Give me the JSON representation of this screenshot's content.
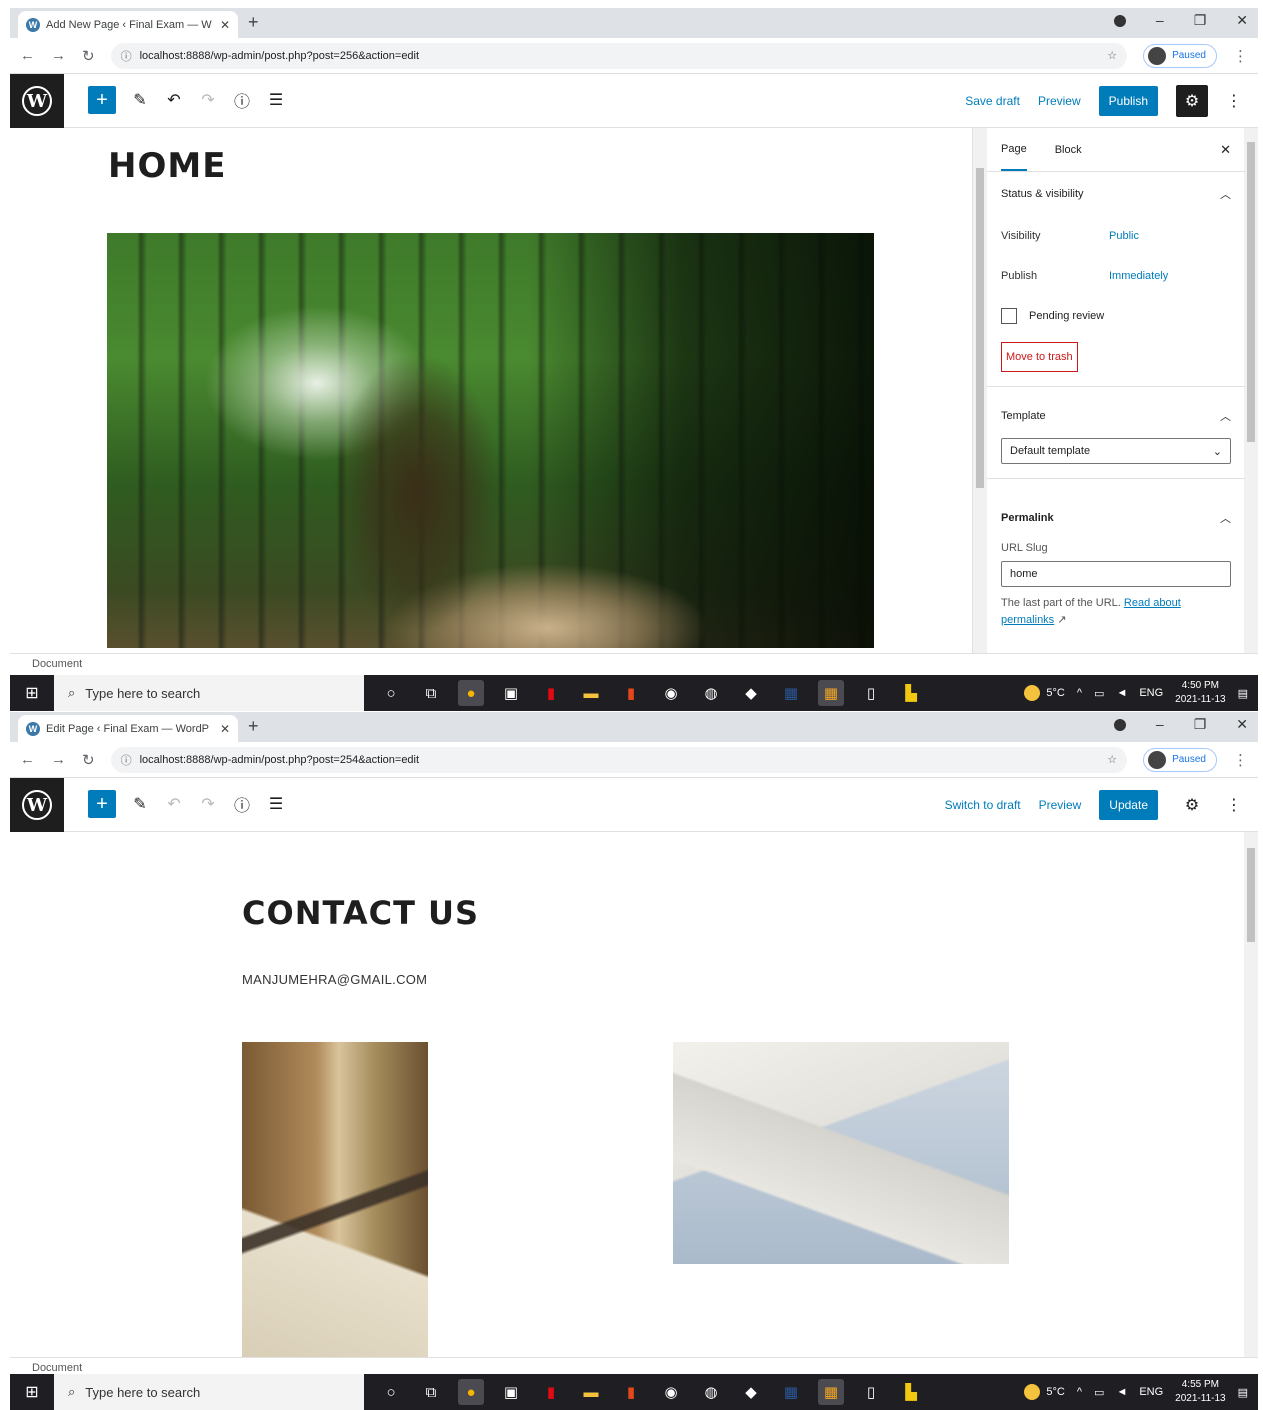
{
  "shot1": {
    "tab_title": "Add New Page ‹ Final Exam — W",
    "url": "localhost:8888/wp-admin/post.php?post=256&action=edit",
    "profile": "Paused",
    "toolbar": {
      "save_draft": "Save draft",
      "preview": "Preview",
      "publish": "Publish"
    },
    "page_title": "HOME",
    "sidebar": {
      "tabs": [
        "Page",
        "Block"
      ],
      "status_heading": "Status & visibility",
      "visibility_label": "Visibility",
      "visibility_value": "Public",
      "publish_label": "Publish",
      "publish_value": "Immediately",
      "pending_review": "Pending review",
      "move_to_trash": "Move to trash",
      "template_heading": "Template",
      "template_value": "Default template",
      "permalink_heading": "Permalink",
      "url_slug_label": "URL Slug",
      "url_slug_value": "home",
      "help_text": "The last part of the URL.",
      "help_link": "Read about permalinks"
    },
    "status": "Document",
    "clock_time": "4:50 PM",
    "clock_date": "2021-11-13"
  },
  "shot2": {
    "tab_title": "Edit Page ‹ Final Exam — WordP",
    "url": "localhost:8888/wp-admin/post.php?post=254&action=edit",
    "profile": "Paused",
    "toolbar": {
      "switch_to_draft": "Switch to draft",
      "preview": "Preview",
      "update": "Update"
    },
    "page_title": "CONTACT US",
    "email": "MANJUMEHRA@GMAIL.COM",
    "status": "Document",
    "clock_time": "4:55 PM",
    "clock_date": "2021-11-13"
  },
  "taskbar": {
    "search_placeholder": "Type here to search",
    "weather": "5°C",
    "language": "ENG"
  },
  "colors": {
    "wp_blue": "#007cba",
    "wp_dark": "#1e1e1e",
    "trash_red": "#cc1818"
  }
}
